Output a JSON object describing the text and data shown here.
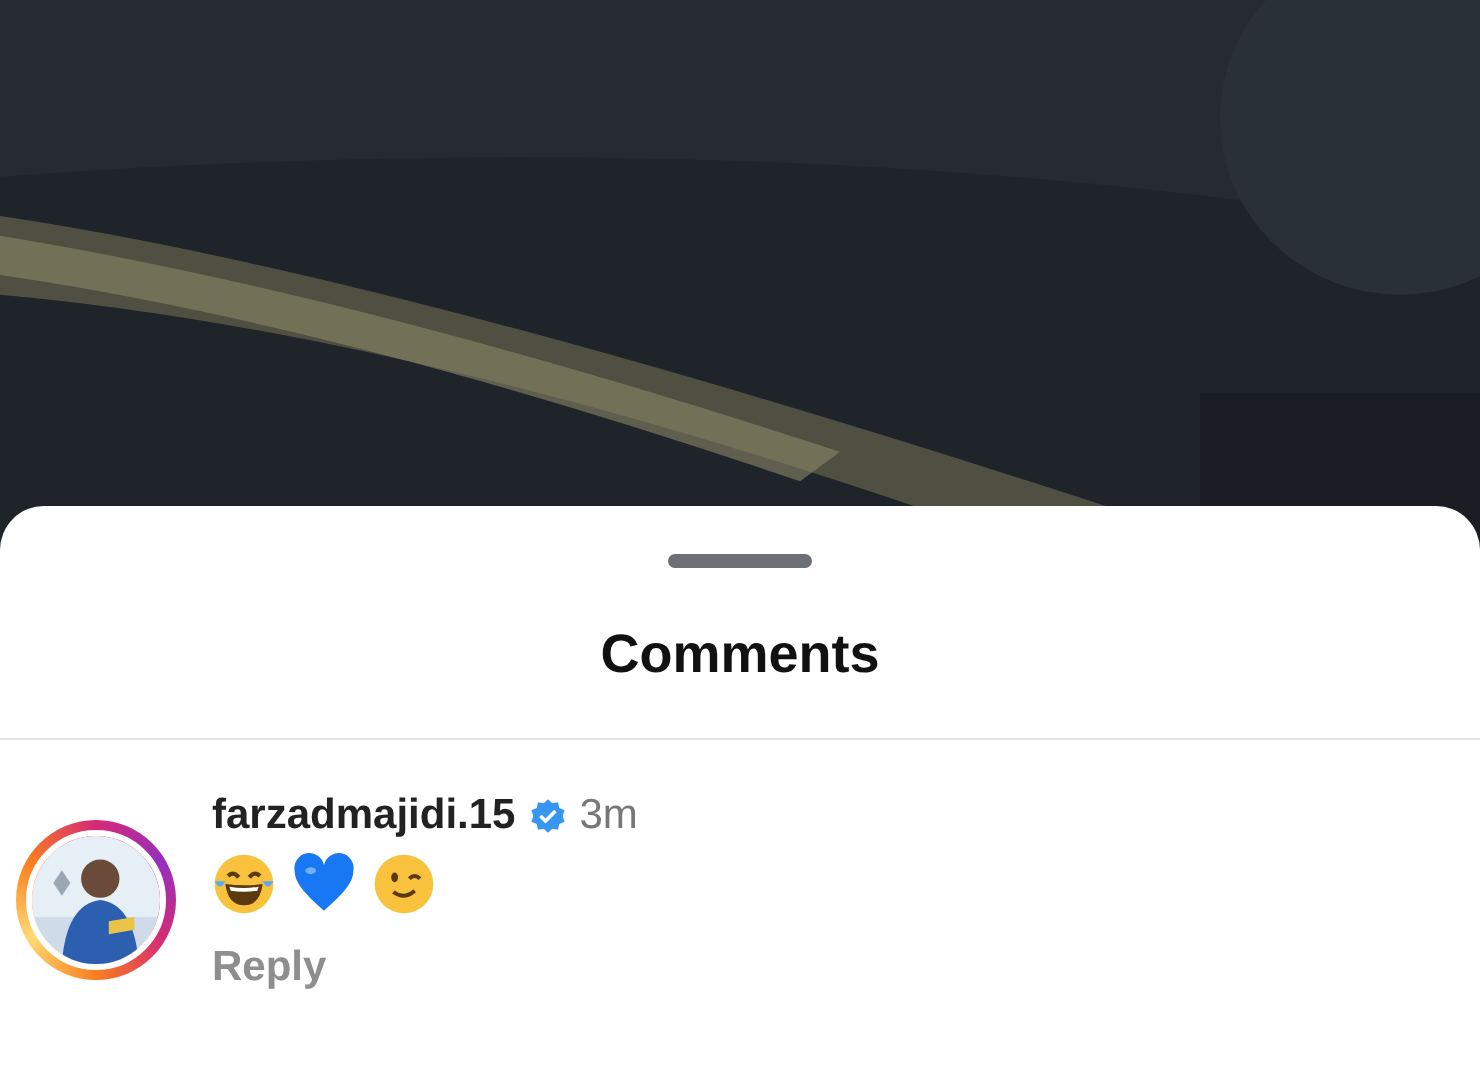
{
  "sheet": {
    "title": "Comments"
  },
  "comments": [
    {
      "username": "farzadmajidi.15",
      "verified": true,
      "time": "3m",
      "story_ring": true,
      "emojis": [
        {
          "kind": "laugh"
        },
        {
          "kind": "blue_heart"
        },
        {
          "kind": "wink"
        }
      ],
      "reply": "Reply"
    }
  ]
}
